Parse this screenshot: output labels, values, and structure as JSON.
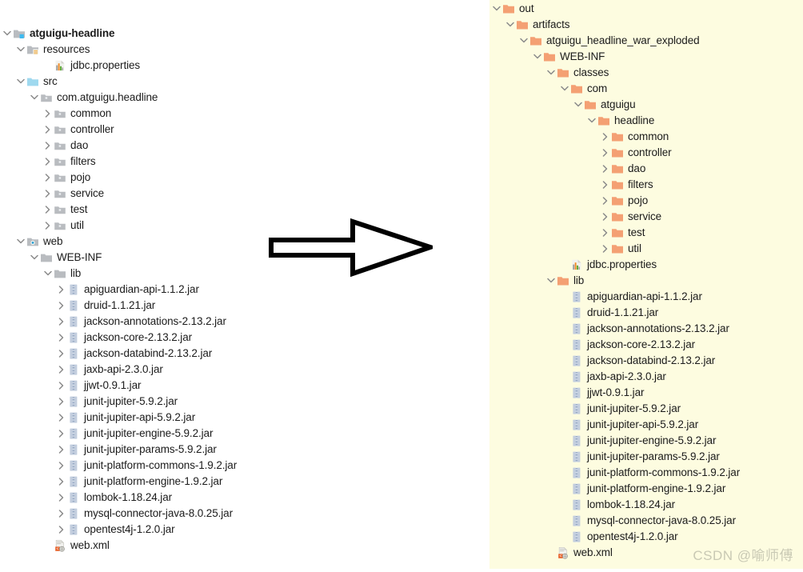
{
  "left_tree": {
    "name": "project-source-tree",
    "items": [
      {
        "label": "atguigu-headline",
        "depth": 0,
        "icon": "module-folder-icon",
        "arrow": "down",
        "bold": true
      },
      {
        "label": "resources",
        "depth": 1,
        "icon": "resources-folder-icon",
        "arrow": "down",
        "bold": false
      },
      {
        "label": "jdbc.properties",
        "depth": 3,
        "icon": "properties-file-icon",
        "arrow": "none",
        "bold": false
      },
      {
        "label": "src",
        "depth": 1,
        "icon": "source-folder-icon",
        "arrow": "down",
        "bold": false
      },
      {
        "label": "com.atguigu.headline",
        "depth": 2,
        "icon": "package-icon",
        "arrow": "down",
        "bold": false
      },
      {
        "label": "common",
        "depth": 3,
        "icon": "package-icon",
        "arrow": "right",
        "bold": false
      },
      {
        "label": "controller",
        "depth": 3,
        "icon": "package-icon",
        "arrow": "right",
        "bold": false
      },
      {
        "label": "dao",
        "depth": 3,
        "icon": "package-icon",
        "arrow": "right",
        "bold": false
      },
      {
        "label": "filters",
        "depth": 3,
        "icon": "package-icon",
        "arrow": "right",
        "bold": false
      },
      {
        "label": "pojo",
        "depth": 3,
        "icon": "package-icon",
        "arrow": "right",
        "bold": false
      },
      {
        "label": "service",
        "depth": 3,
        "icon": "package-icon",
        "arrow": "right",
        "bold": false
      },
      {
        "label": "test",
        "depth": 3,
        "icon": "package-icon",
        "arrow": "right",
        "bold": false
      },
      {
        "label": "util",
        "depth": 3,
        "icon": "package-icon",
        "arrow": "right",
        "bold": false
      },
      {
        "label": "web",
        "depth": 1,
        "icon": "web-folder-icon",
        "arrow": "down",
        "bold": false
      },
      {
        "label": "WEB-INF",
        "depth": 2,
        "icon": "plain-folder-icon",
        "arrow": "down",
        "bold": false
      },
      {
        "label": "lib",
        "depth": 3,
        "icon": "plain-folder-icon",
        "arrow": "down",
        "bold": false
      },
      {
        "label": "apiguardian-api-1.1.2.jar",
        "depth": 4,
        "icon": "jar-file-icon",
        "arrow": "right",
        "bold": false
      },
      {
        "label": "druid-1.1.21.jar",
        "depth": 4,
        "icon": "jar-file-icon",
        "arrow": "right",
        "bold": false
      },
      {
        "label": "jackson-annotations-2.13.2.jar",
        "depth": 4,
        "icon": "jar-file-icon",
        "arrow": "right",
        "bold": false
      },
      {
        "label": "jackson-core-2.13.2.jar",
        "depth": 4,
        "icon": "jar-file-icon",
        "arrow": "right",
        "bold": false
      },
      {
        "label": "jackson-databind-2.13.2.jar",
        "depth": 4,
        "icon": "jar-file-icon",
        "arrow": "right",
        "bold": false
      },
      {
        "label": "jaxb-api-2.3.0.jar",
        "depth": 4,
        "icon": "jar-file-icon",
        "arrow": "right",
        "bold": false
      },
      {
        "label": "jjwt-0.9.1.jar",
        "depth": 4,
        "icon": "jar-file-icon",
        "arrow": "right",
        "bold": false
      },
      {
        "label": "junit-jupiter-5.9.2.jar",
        "depth": 4,
        "icon": "jar-file-icon",
        "arrow": "right",
        "bold": false
      },
      {
        "label": "junit-jupiter-api-5.9.2.jar",
        "depth": 4,
        "icon": "jar-file-icon",
        "arrow": "right",
        "bold": false
      },
      {
        "label": "junit-jupiter-engine-5.9.2.jar",
        "depth": 4,
        "icon": "jar-file-icon",
        "arrow": "right",
        "bold": false
      },
      {
        "label": "junit-jupiter-params-5.9.2.jar",
        "depth": 4,
        "icon": "jar-file-icon",
        "arrow": "right",
        "bold": false
      },
      {
        "label": "junit-platform-commons-1.9.2.jar",
        "depth": 4,
        "icon": "jar-file-icon",
        "arrow": "right",
        "bold": false
      },
      {
        "label": "junit-platform-engine-1.9.2.jar",
        "depth": 4,
        "icon": "jar-file-icon",
        "arrow": "right",
        "bold": false
      },
      {
        "label": "lombok-1.18.24.jar",
        "depth": 4,
        "icon": "jar-file-icon",
        "arrow": "right",
        "bold": false
      },
      {
        "label": "mysql-connector-java-8.0.25.jar",
        "depth": 4,
        "icon": "jar-file-icon",
        "arrow": "right",
        "bold": false
      },
      {
        "label": "opentest4j-1.2.0.jar",
        "depth": 4,
        "icon": "jar-file-icon",
        "arrow": "right",
        "bold": false
      },
      {
        "label": "web.xml",
        "depth": 3,
        "icon": "xml-file-icon",
        "arrow": "none",
        "bold": false
      }
    ]
  },
  "right_tree": {
    "name": "artifact-output-tree",
    "items": [
      {
        "label": "out",
        "depth": 0,
        "icon": "orange-folder-icon",
        "arrow": "down"
      },
      {
        "label": "artifacts",
        "depth": 1,
        "icon": "orange-folder-icon",
        "arrow": "down"
      },
      {
        "label": "atguigu_headline_war_exploded",
        "depth": 2,
        "icon": "orange-folder-icon",
        "arrow": "down"
      },
      {
        "label": "WEB-INF",
        "depth": 3,
        "icon": "orange-folder-icon",
        "arrow": "down"
      },
      {
        "label": "classes",
        "depth": 4,
        "icon": "orange-folder-icon",
        "arrow": "down"
      },
      {
        "label": "com",
        "depth": 5,
        "icon": "orange-folder-icon",
        "arrow": "down"
      },
      {
        "label": "atguigu",
        "depth": 6,
        "icon": "orange-folder-icon",
        "arrow": "down"
      },
      {
        "label": "headline",
        "depth": 7,
        "icon": "orange-folder-icon",
        "arrow": "down"
      },
      {
        "label": "common",
        "depth": 8,
        "icon": "orange-folder-icon",
        "arrow": "right"
      },
      {
        "label": "controller",
        "depth": 8,
        "icon": "orange-folder-icon",
        "arrow": "right"
      },
      {
        "label": "dao",
        "depth": 8,
        "icon": "orange-folder-icon",
        "arrow": "right"
      },
      {
        "label": "filters",
        "depth": 8,
        "icon": "orange-folder-icon",
        "arrow": "right"
      },
      {
        "label": "pojo",
        "depth": 8,
        "icon": "orange-folder-icon",
        "arrow": "right"
      },
      {
        "label": "service",
        "depth": 8,
        "icon": "orange-folder-icon",
        "arrow": "right"
      },
      {
        "label": "test",
        "depth": 8,
        "icon": "orange-folder-icon",
        "arrow": "right"
      },
      {
        "label": "util",
        "depth": 8,
        "icon": "orange-folder-icon",
        "arrow": "right"
      },
      {
        "label": "jdbc.properties",
        "depth": 5,
        "icon": "properties-file-icon",
        "arrow": "none"
      },
      {
        "label": "lib",
        "depth": 4,
        "icon": "orange-folder-icon",
        "arrow": "down"
      },
      {
        "label": "apiguardian-api-1.1.2.jar",
        "depth": 5,
        "icon": "jar-file-icon",
        "arrow": "none"
      },
      {
        "label": "druid-1.1.21.jar",
        "depth": 5,
        "icon": "jar-file-icon",
        "arrow": "none"
      },
      {
        "label": "jackson-annotations-2.13.2.jar",
        "depth": 5,
        "icon": "jar-file-icon",
        "arrow": "none"
      },
      {
        "label": "jackson-core-2.13.2.jar",
        "depth": 5,
        "icon": "jar-file-icon",
        "arrow": "none"
      },
      {
        "label": "jackson-databind-2.13.2.jar",
        "depth": 5,
        "icon": "jar-file-icon",
        "arrow": "none"
      },
      {
        "label": "jaxb-api-2.3.0.jar",
        "depth": 5,
        "icon": "jar-file-icon",
        "arrow": "none"
      },
      {
        "label": "jjwt-0.9.1.jar",
        "depth": 5,
        "icon": "jar-file-icon",
        "arrow": "none"
      },
      {
        "label": "junit-jupiter-5.9.2.jar",
        "depth": 5,
        "icon": "jar-file-icon",
        "arrow": "none"
      },
      {
        "label": "junit-jupiter-api-5.9.2.jar",
        "depth": 5,
        "icon": "jar-file-icon",
        "arrow": "none"
      },
      {
        "label": "junit-jupiter-engine-5.9.2.jar",
        "depth": 5,
        "icon": "jar-file-icon",
        "arrow": "none"
      },
      {
        "label": "junit-jupiter-params-5.9.2.jar",
        "depth": 5,
        "icon": "jar-file-icon",
        "arrow": "none"
      },
      {
        "label": "junit-platform-commons-1.9.2.jar",
        "depth": 5,
        "icon": "jar-file-icon",
        "arrow": "none"
      },
      {
        "label": "junit-platform-engine-1.9.2.jar",
        "depth": 5,
        "icon": "jar-file-icon",
        "arrow": "none"
      },
      {
        "label": "lombok-1.18.24.jar",
        "depth": 5,
        "icon": "jar-file-icon",
        "arrow": "none"
      },
      {
        "label": "mysql-connector-java-8.0.25.jar",
        "depth": 5,
        "icon": "jar-file-icon",
        "arrow": "none"
      },
      {
        "label": "opentest4j-1.2.0.jar",
        "depth": 5,
        "icon": "jar-file-icon",
        "arrow": "none"
      },
      {
        "label": "web.xml",
        "depth": 4,
        "icon": "xml-file-icon",
        "arrow": "none"
      }
    ]
  },
  "arrow_annotation": {
    "name": "transform-arrow",
    "direction": "right"
  },
  "watermark": {
    "text": "CSDN @喻师傅"
  },
  "colors": {
    "panel_background": "#fdfce0",
    "folder_orange": "#f4a073",
    "folder_gray": "#b9bcc0",
    "folder_blue": "#9fd9ef",
    "jar_blue": "#b8c4d6",
    "text": "#1b1b1b",
    "chevron": "#8a8a8a",
    "watermark": "#c9c9b4"
  }
}
